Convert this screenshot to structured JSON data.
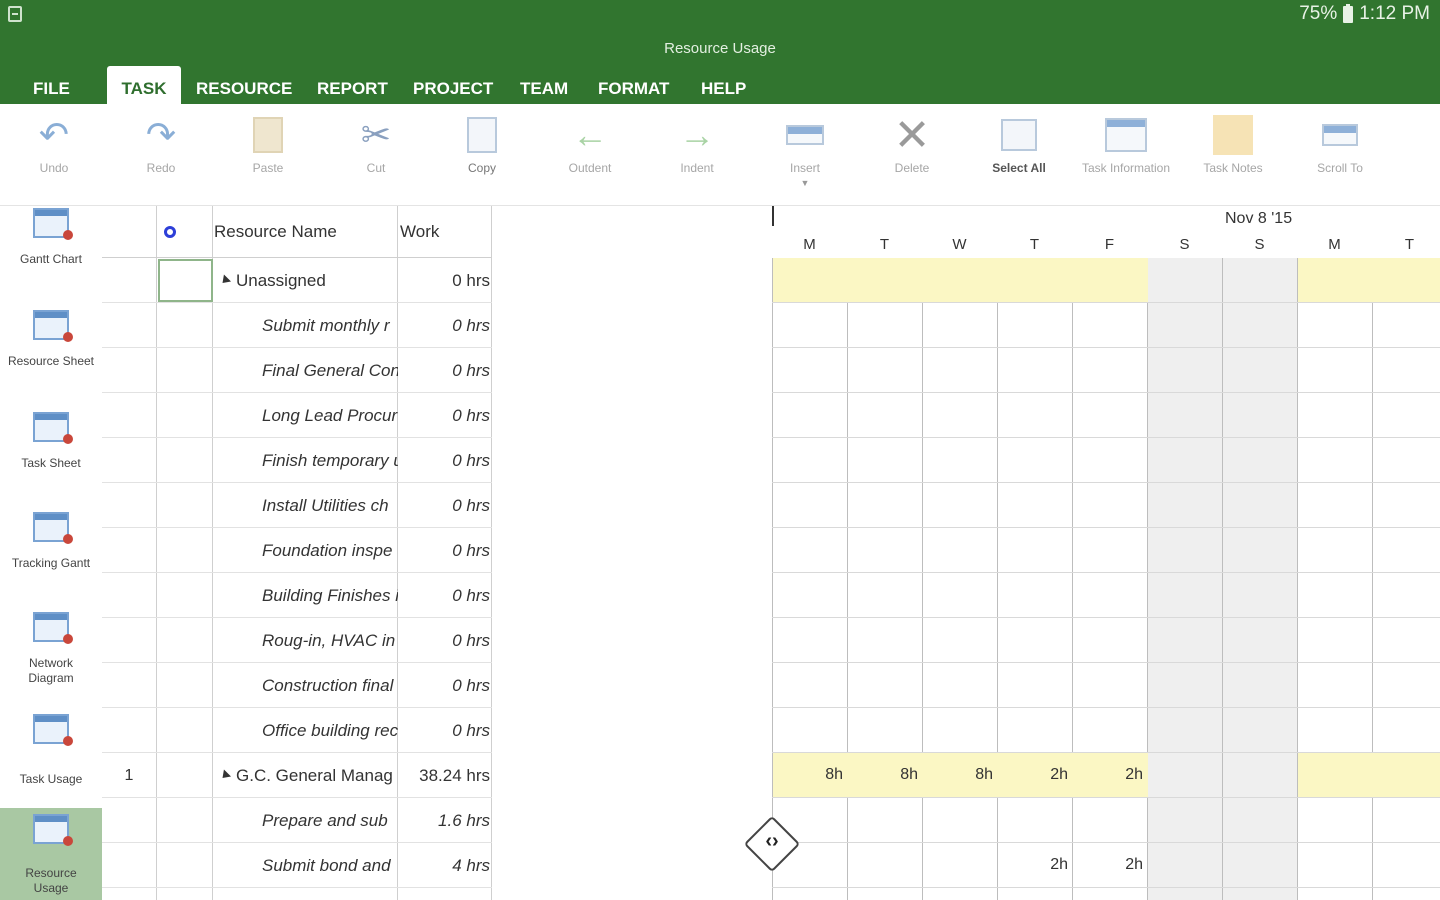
{
  "status": {
    "battery": "75%",
    "time": "1:12 PM"
  },
  "title": "Resource Usage",
  "tabs": [
    "FILE",
    "TASK",
    "RESOURCE",
    "REPORT",
    "PROJECT",
    "TEAM",
    "FORMAT",
    "HELP"
  ],
  "active_tab": "TASK",
  "ribbon": [
    {
      "label": "Undo",
      "icon": "undo-icon"
    },
    {
      "label": "Redo",
      "icon": "redo-icon"
    },
    {
      "label": "Paste",
      "icon": "paste-icon"
    },
    {
      "label": "Cut",
      "icon": "cut-icon"
    },
    {
      "label": "Copy",
      "icon": "copy-icon"
    },
    {
      "label": "Outdent",
      "icon": "outdent-icon"
    },
    {
      "label": "Indent",
      "icon": "indent-icon"
    },
    {
      "label": "Insert",
      "icon": "insert-icon"
    },
    {
      "label": "Delete",
      "icon": "delete-icon"
    },
    {
      "label": "Select All",
      "icon": "select-all-icon"
    },
    {
      "label": "Task Information",
      "icon": "task-information-icon"
    },
    {
      "label": "Task Notes",
      "icon": "task-notes-icon"
    },
    {
      "label": "Scroll To",
      "icon": "scroll-to-icon"
    }
  ],
  "views": [
    {
      "label": "Gantt Chart"
    },
    {
      "label": "Resource Sheet"
    },
    {
      "label": "Task Sheet"
    },
    {
      "label": "Tracking Gantt"
    },
    {
      "label": "Network Diagram"
    },
    {
      "label": "Task Usage"
    },
    {
      "label": "Resource Usage"
    }
  ],
  "grid": {
    "headers": {
      "resource_name": "Resource Name",
      "work": "Work"
    },
    "rows": [
      {
        "id": "",
        "name": "Unassigned",
        "work": "0 hrs",
        "level": "parent"
      },
      {
        "id": "",
        "name": "Submit monthly r",
        "work": "0 hrs",
        "level": "child"
      },
      {
        "id": "",
        "name": "Final General Con",
        "work": "0 hrs",
        "level": "child"
      },
      {
        "id": "",
        "name": "Long Lead Procur",
        "work": "0 hrs",
        "level": "child"
      },
      {
        "id": "",
        "name": "Finish temporary u",
        "work": "0 hrs",
        "level": "child"
      },
      {
        "id": "",
        "name": "Install Utilities ch",
        "work": "0 hrs",
        "level": "child"
      },
      {
        "id": "",
        "name": "Foundation inspe",
        "work": "0 hrs",
        "level": "child"
      },
      {
        "id": "",
        "name": "Building Finishes i",
        "work": "0 hrs",
        "level": "child"
      },
      {
        "id": "",
        "name": "Roug-in, HVAC  in",
        "work": "0 hrs",
        "level": "child"
      },
      {
        "id": "",
        "name": "Construction final",
        "work": "0 hrs",
        "level": "child"
      },
      {
        "id": "",
        "name": "Office building rec",
        "work": "0 hrs",
        "level": "child"
      },
      {
        "id": "1",
        "name": "G.C. General Manag",
        "work": "38.24 hrs",
        "level": "parent"
      },
      {
        "id": "",
        "name": "Prepare and sub",
        "work": "1.6 hrs",
        "level": "child"
      },
      {
        "id": "",
        "name": "Submit bond and",
        "work": "4 hrs",
        "level": "child"
      }
    ]
  },
  "timescale": {
    "week_label": "Nov 8 '15",
    "days": [
      "M",
      "T",
      "W",
      "T",
      "F",
      "S",
      "S",
      "M",
      "T"
    ],
    "rows": [
      {
        "values": [
          "",
          "",
          "",
          "",
          "",
          "",
          "",
          "",
          ""
        ],
        "highlight": true
      },
      {
        "values": [
          "",
          "",
          "",
          "",
          "",
          "",
          "",
          "",
          ""
        ],
        "highlight": false
      },
      {
        "values": [
          "",
          "",
          "",
          "",
          "",
          "",
          "",
          "",
          ""
        ],
        "highlight": false
      },
      {
        "values": [
          "",
          "",
          "",
          "",
          "",
          "",
          "",
          "",
          ""
        ],
        "highlight": false
      },
      {
        "values": [
          "",
          "",
          "",
          "",
          "",
          "",
          "",
          "",
          ""
        ],
        "highlight": false
      },
      {
        "values": [
          "",
          "",
          "",
          "",
          "",
          "",
          "",
          "",
          ""
        ],
        "highlight": false
      },
      {
        "values": [
          "",
          "",
          "",
          "",
          "",
          "",
          "",
          "",
          ""
        ],
        "highlight": false
      },
      {
        "values": [
          "",
          "",
          "",
          "",
          "",
          "",
          "",
          "",
          ""
        ],
        "highlight": false
      },
      {
        "values": [
          "",
          "",
          "",
          "",
          "",
          "",
          "",
          "",
          ""
        ],
        "highlight": false
      },
      {
        "values": [
          "",
          "",
          "",
          "",
          "",
          "",
          "",
          "",
          ""
        ],
        "highlight": false
      },
      {
        "values": [
          "",
          "",
          "",
          "",
          "",
          "",
          "",
          "",
          ""
        ],
        "highlight": false
      },
      {
        "values": [
          "8h",
          "8h",
          "8h",
          "2h",
          "2h",
          "",
          "",
          "",
          ""
        ],
        "highlight": true
      },
      {
        "values": [
          "",
          "",
          "",
          "",
          "",
          "",
          "",
          "",
          ""
        ],
        "highlight": false
      },
      {
        "values": [
          "",
          "",
          "",
          "2h",
          "2h",
          "",
          "",
          "",
          ""
        ],
        "highlight": false
      }
    ]
  },
  "colors": {
    "brand": "#31752f",
    "highlight": "#fbf7c4",
    "active_view": "#a9c8a3"
  }
}
